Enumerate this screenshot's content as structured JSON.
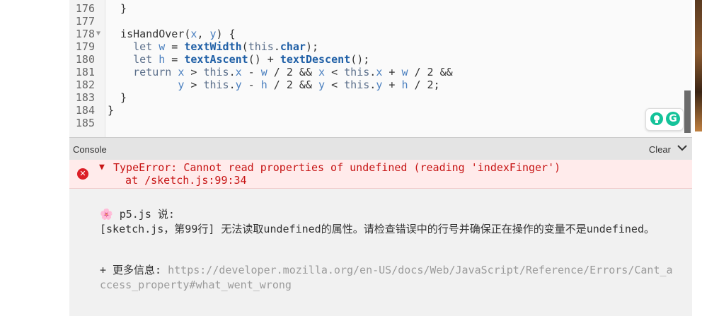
{
  "editor": {
    "lines": [
      {
        "num": "176",
        "fold": "",
        "code": "  }"
      },
      {
        "num": "177",
        "fold": "",
        "code": ""
      },
      {
        "num": "178",
        "fold": "▼",
        "code": "  isHandOver(x, y) {"
      },
      {
        "num": "179",
        "fold": "",
        "code": "    let w = textWidth(this.char);"
      },
      {
        "num": "180",
        "fold": "",
        "code": "    let h = textAscent() + textDescent();"
      },
      {
        "num": "181",
        "fold": "",
        "code": "    return x > this.x - w / 2 && x < this.x + w / 2 &&"
      },
      {
        "num": "182",
        "fold": "",
        "code": "           y > this.y - h / 2 && y < this.y + h / 2;"
      },
      {
        "num": "183",
        "fold": "",
        "code": "  }"
      },
      {
        "num": "184",
        "fold": "",
        "code": "}"
      },
      {
        "num": "185",
        "fold": "",
        "code": ""
      }
    ]
  },
  "grammarly": {
    "logo": "G"
  },
  "console": {
    "title": "Console",
    "clear_label": "Clear",
    "error": {
      "icon": "✕",
      "expand": "▼",
      "message": "TypeError: Cannot read properties of undefined (reading 'indexFinger')",
      "location": "at /sketch.js:99:34"
    },
    "friendly": {
      "flower": "🌸",
      "header": "p5.js 说:",
      "message": "[sketch.js，第99行] 无法读取undefined的属性。请检查错误中的行号并确保正在操作的变量不是undefined。",
      "more_prefix": "+ 更多信息: ",
      "more_link": "https://developer.mozilla.org/en-US/docs/Web/JavaScript/Reference/Errors/Cant_access_property#what_went_wrong"
    }
  },
  "colors": {
    "error_red": "#c71515",
    "error_bg": "#ffebeb",
    "grammarly_green": "#15c39a"
  }
}
